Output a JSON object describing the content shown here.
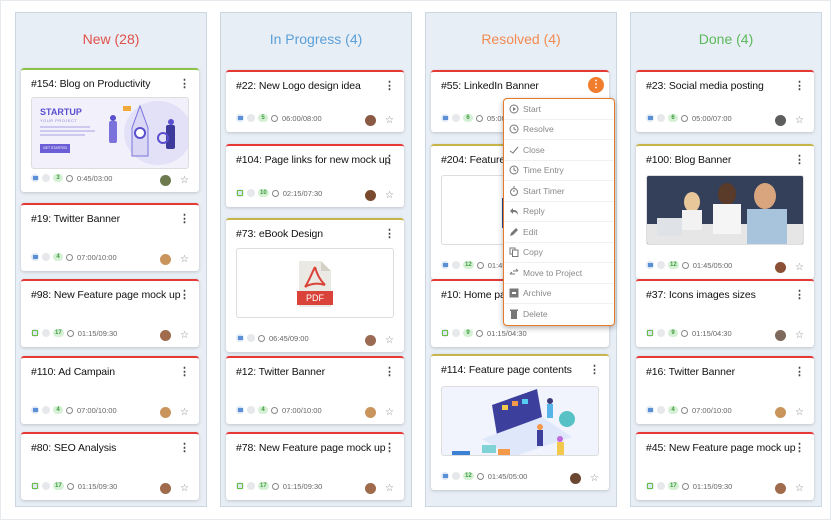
{
  "columns": [
    {
      "title": "New (28)",
      "color": "#e0504a",
      "cards": [
        {
          "title": "#154: Blog on Productivity",
          "type": "blue",
          "comments": "3",
          "time": "0:45/03:00",
          "thumb": "startup-illustration",
          "thumb_text": {
            "headline": "STARTUP",
            "sub": "YOUR PROJECT",
            "button": "GET STARTED"
          }
        },
        {
          "title": "#19: Twitter Banner",
          "type": "blue",
          "comments": "4",
          "time": "07:00/10:00"
        },
        {
          "title": "#98: New Feature page mock up",
          "type": "green",
          "comments": "17",
          "time": "01:15/09:30"
        },
        {
          "title": "#110: Ad Campain",
          "type": "blue",
          "comments": "4",
          "time": "07:00/10:00"
        },
        {
          "title": "#80: SEO Analysis",
          "type": "green",
          "comments": "17",
          "time": "01:15/09:30"
        }
      ]
    },
    {
      "title": "In Progress (4)",
      "color": "#5b9fd8",
      "cards": [
        {
          "title": "#22: New Logo design idea",
          "type": "blue",
          "comments": "5",
          "time": "06:00/08:00"
        },
        {
          "title": "#104: Page links for new mock up",
          "type": "green",
          "comments": "10",
          "time": "02:15/07:30"
        },
        {
          "title": "#73: eBook Design",
          "type": "blue",
          "comments": "",
          "time": "06:45/09:00",
          "thumb": "pdf-file",
          "thumb_text": {
            "label": "PDF"
          }
        },
        {
          "title": "#12: Twitter Banner",
          "type": "blue",
          "comments": "4",
          "time": "07:00/10:00"
        },
        {
          "title": "#78: New Feature page mock up",
          "type": "green",
          "comments": "17",
          "time": "01:15/09:30"
        }
      ]
    },
    {
      "title": "Resolved (4)",
      "color": "#f28b52",
      "cards": [
        {
          "title": "#55: LinkedIn Banner",
          "type": "blue",
          "comments": "6",
          "time": "05:00/07:00"
        },
        {
          "title": "#204: Feature",
          "type": "blue",
          "comments": "12",
          "time": "01:45/05:00",
          "thumb": "blank"
        },
        {
          "title": "#10: Home pa",
          "type": "green",
          "comments": "9",
          "time": "01:15/04:30"
        },
        {
          "title": "#114: Feature page contents",
          "type": "blue",
          "comments": "12",
          "time": "01:45/05:00",
          "thumb": "isometric-laptop-illustration"
        }
      ]
    },
    {
      "title": "Done (4)",
      "color": "#5cb85c",
      "cards": [
        {
          "title": "#23: Social media posting",
          "type": "blue",
          "comments": "6",
          "time": "05:00/07:00"
        },
        {
          "title": "#100: Blog Banner",
          "type": "blue",
          "comments": "12",
          "time": "01:45/05:00",
          "thumb": "office-team-photo"
        },
        {
          "title": "#37: Icons images sizes",
          "type": "green",
          "comments": "9",
          "time": "01:15/04:30"
        },
        {
          "title": "#16: Twitter Banner",
          "type": "blue",
          "comments": "4",
          "time": "07:00/10:00"
        },
        {
          "title": "#45: New Feature page mock up",
          "type": "green",
          "comments": "17",
          "time": "01:15/09:30"
        }
      ]
    }
  ],
  "context_menu": {
    "items": [
      {
        "label": "Start",
        "icon": "play-circle-icon"
      },
      {
        "label": "Resolve",
        "icon": "history-icon"
      },
      {
        "label": "Close",
        "icon": "check-icon"
      },
      {
        "label": "Time Entry",
        "icon": "clock-icon"
      },
      {
        "label": "Start Timer",
        "icon": "stopwatch-icon"
      },
      {
        "label": "Reply",
        "icon": "reply-icon"
      },
      {
        "label": "Edit",
        "icon": "pencil-icon"
      },
      {
        "label": "Copy",
        "icon": "copy-icon"
      },
      {
        "label": "Move to Project",
        "icon": "transfer-icon"
      },
      {
        "label": "Archive",
        "icon": "archive-icon"
      },
      {
        "label": "Delete",
        "icon": "trash-icon"
      }
    ]
  },
  "glyphs": {
    "kebab": "⋮",
    "star": "☆",
    "attach": "⌀"
  }
}
